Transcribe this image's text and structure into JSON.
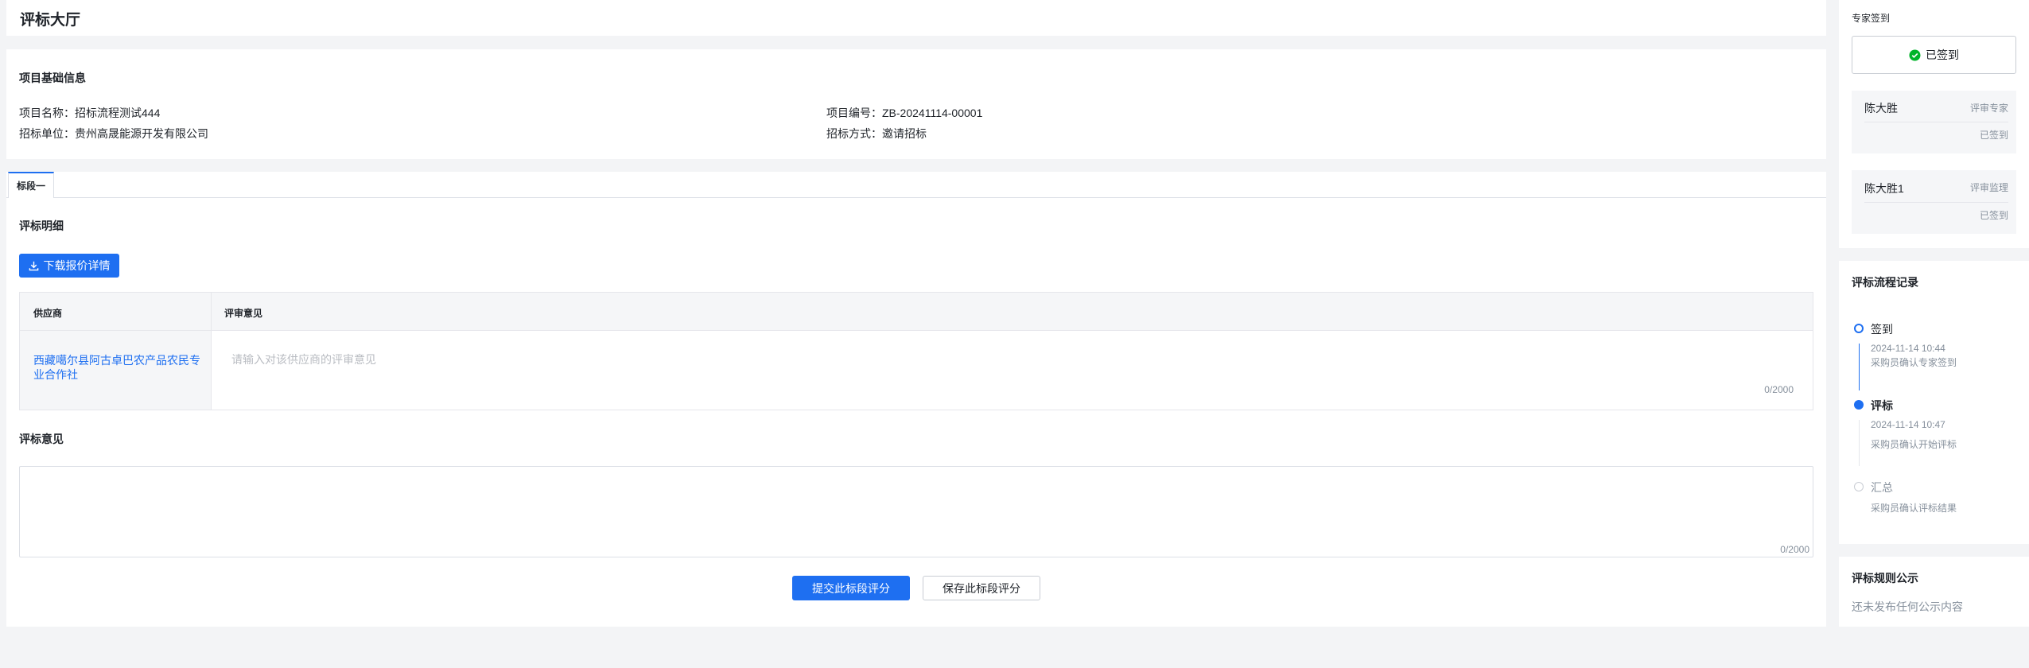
{
  "header": {
    "title": "评标大厅"
  },
  "project_info": {
    "section_title": "项目基础信息",
    "name_label": "项目名称：",
    "name_value": "招标流程测试444",
    "code_label": "项目编号：",
    "code_value": "ZB-20241114-00001",
    "unit_label": "招标单位：",
    "unit_value": "贵州高晟能源开发有限公司",
    "method_label": "招标方式：",
    "method_value": "邀请招标"
  },
  "tabs": [
    {
      "label": "标段一",
      "active": true
    }
  ],
  "evaluation": {
    "detail_title": "评标明细",
    "download_button": "下载报价详情",
    "table": {
      "headers": [
        "供应商",
        "评审意见"
      ],
      "rows": [
        {
          "supplier": "西藏噶尔县阿古卓巴农产品农民专业合作社",
          "comment_placeholder": "请输入对该供应商的评审意见",
          "counter": "0/2000"
        }
      ]
    },
    "opinion_title": "评标意见",
    "opinion_counter": "0/2000",
    "submit_button": "提交此标段评分",
    "save_button": "保存此标段评分"
  },
  "sidebar": {
    "signin_title": "专家签到",
    "signin_button": "已签到",
    "experts": [
      {
        "name": "陈大胜",
        "role": "评审专家",
        "status": "已签到"
      },
      {
        "name": "陈大胜1",
        "role": "评审监理",
        "status": "已签到"
      }
    ],
    "process_title": "评标流程记录",
    "process_steps": [
      {
        "name": "签到",
        "time": "2024-11-14 10:44",
        "desc": "采购员确认专家签到",
        "state": "done"
      },
      {
        "name": "评标",
        "time": "2024-11-14 10:47",
        "desc": "采购员确认开始评标",
        "state": "current"
      },
      {
        "name": "汇总",
        "time": "",
        "desc": "采购员确认评标结果",
        "state": "pending"
      }
    ],
    "rules_title": "评标规则公示",
    "rules_empty": "还未发布任何公示内容"
  },
  "colors": {
    "primary": "#1e6ff1",
    "success": "#00b42a",
    "page_bg": "#f3f4f6"
  }
}
